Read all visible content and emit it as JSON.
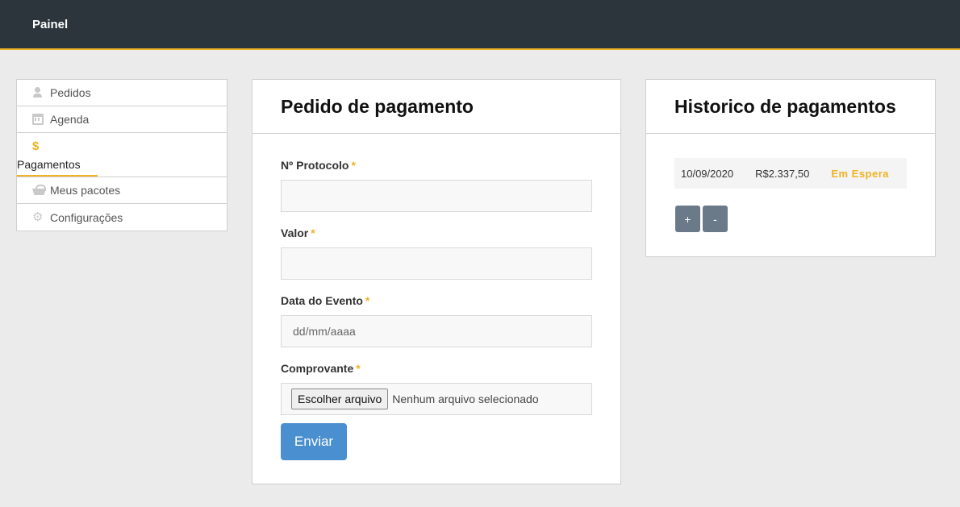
{
  "header": {
    "brand": "Painel"
  },
  "sidebar": {
    "items": [
      {
        "label": "Pedidos",
        "icon": "user-icon"
      },
      {
        "label": "Agenda",
        "icon": "calendar-icon"
      },
      {
        "label": "Pagamentos",
        "icon": "dollar-icon",
        "active": true
      },
      {
        "label": "Meus pacotes",
        "icon": "basket-icon"
      },
      {
        "label": "Configurações",
        "icon": "gear-icon"
      }
    ]
  },
  "payment_form": {
    "title": "Pedido de pagamento",
    "fields": {
      "protocolo": {
        "label": "Nº Protocolo",
        "required_mark": "*",
        "value": ""
      },
      "valor": {
        "label": "Valor",
        "required_mark": "*",
        "value": ""
      },
      "data": {
        "label": "Data do Evento",
        "required_mark": "*",
        "placeholder": "dd/mm/aaaa"
      },
      "comprovante": {
        "label": "Comprovante",
        "required_mark": "*",
        "button_label": "Escolher arquivo",
        "status": "Nenhum arquivo selecionado"
      }
    },
    "submit_label": "Enviar"
  },
  "history": {
    "title": "Historico de pagamentos",
    "rows": [
      {
        "date": "10/09/2020",
        "amount": "R$2.337,50",
        "status": "Em Espera"
      }
    ],
    "plus_label": "+",
    "minus_label": "-"
  },
  "colors": {
    "accent": "#f0b323",
    "topbar": "#2b353b",
    "primary": "#4a8fcf"
  }
}
